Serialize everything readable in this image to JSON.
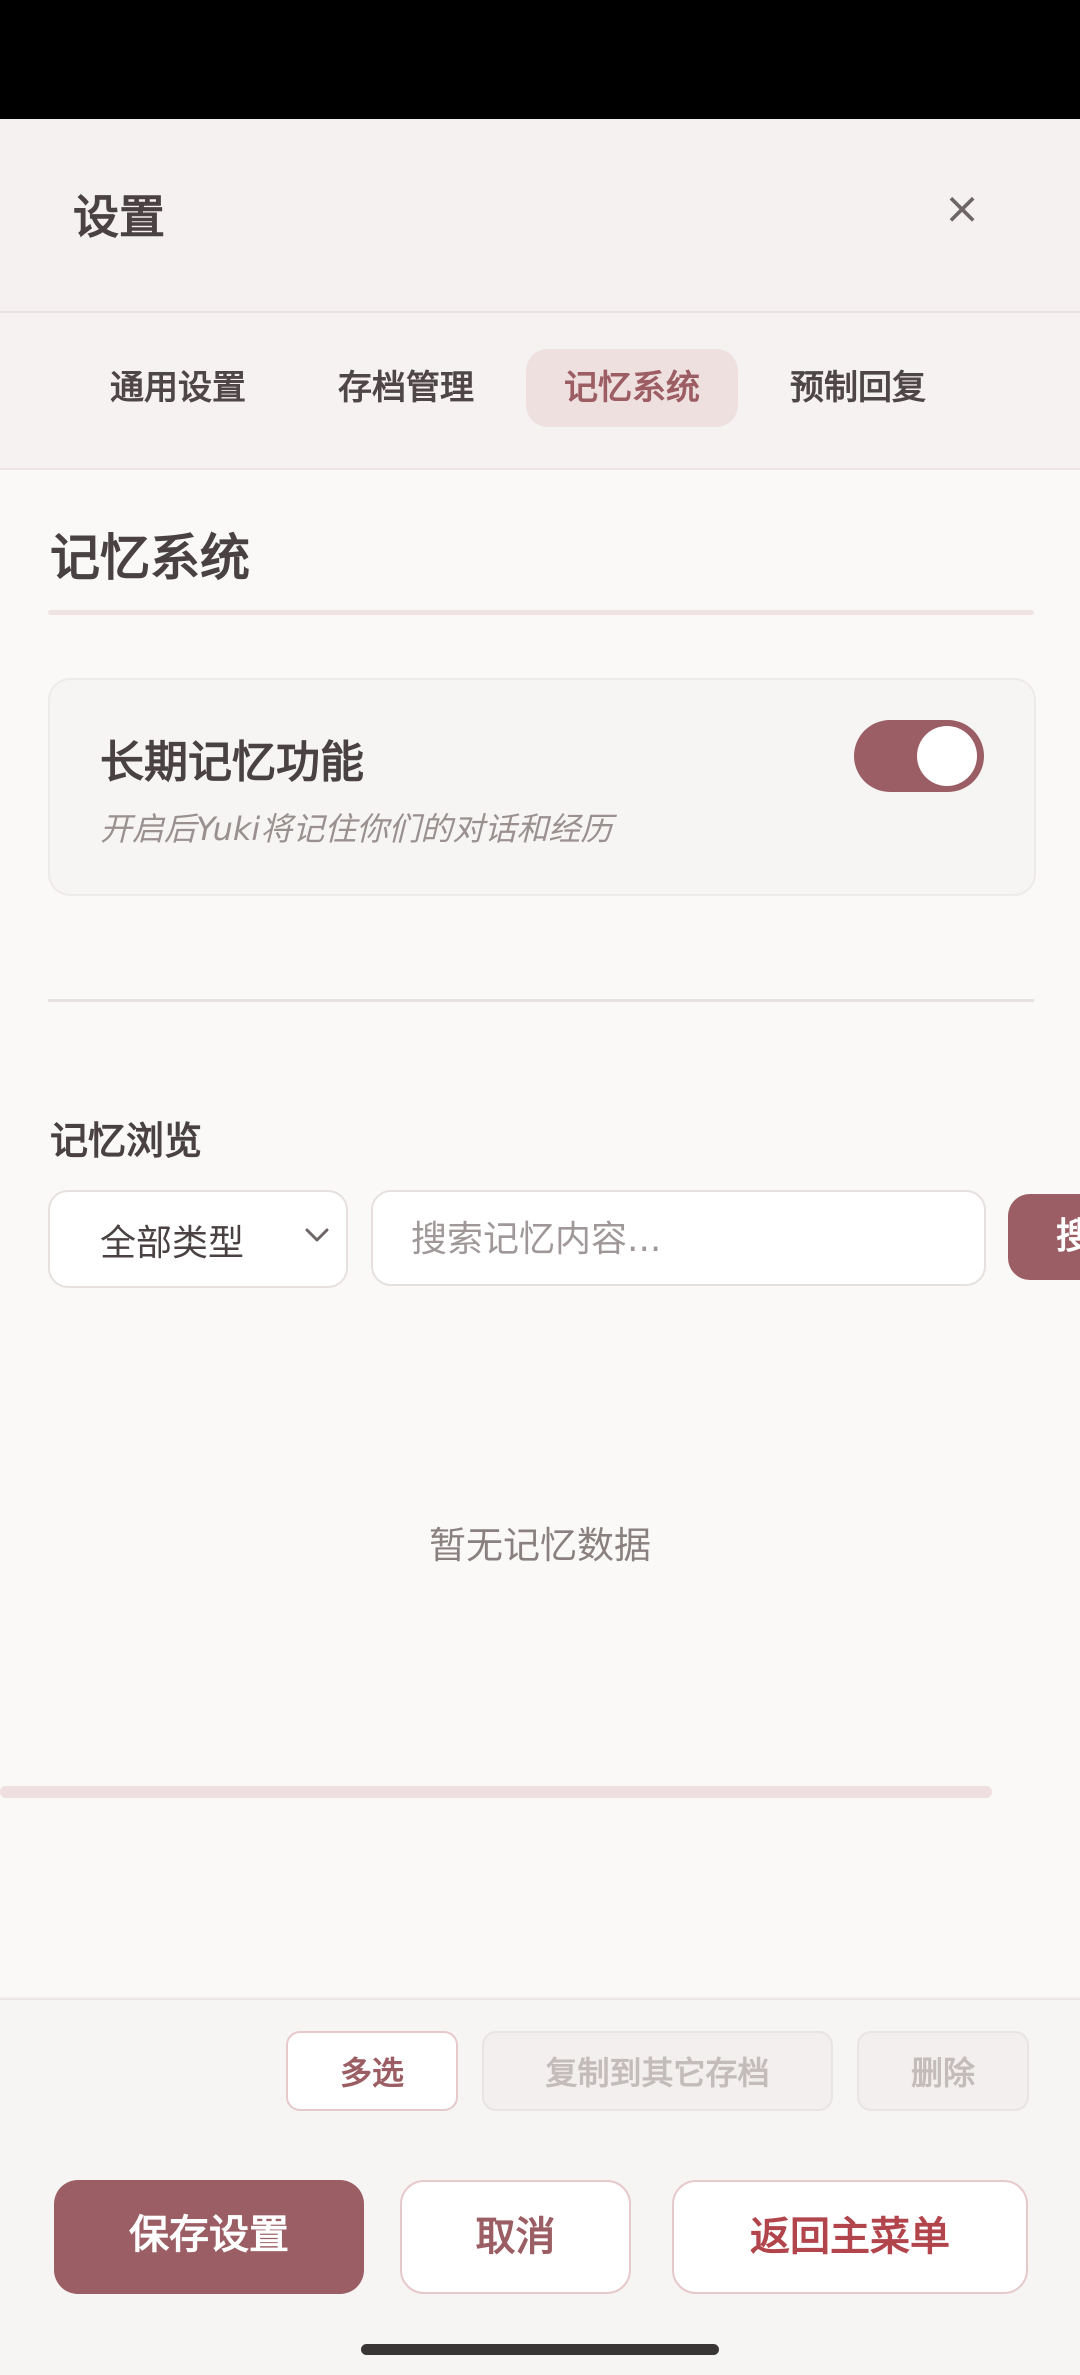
{
  "header": {
    "title": "设置",
    "close_symbol": "×"
  },
  "tabs": [
    {
      "label": "通用设置",
      "active": false
    },
    {
      "label": "存档管理",
      "active": false
    },
    {
      "label": "记忆系统",
      "active": true
    },
    {
      "label": "预制回复",
      "active": false
    }
  ],
  "section": {
    "title": "记忆系统"
  },
  "long_term_memory": {
    "label": "长期记忆功能",
    "description": "开启后Yuki将记住你们的对话和经历",
    "enabled": true
  },
  "browse": {
    "title": "记忆浏览",
    "type_select": "全部类型",
    "search_placeholder": "搜索记忆内容...",
    "search_button": "搜索",
    "empty_text": "暂无记忆数据"
  },
  "actions": {
    "multi_select": "多选",
    "copy_to_other": "复制到其它存档",
    "delete": "删除"
  },
  "footer": {
    "save": "保存设置",
    "cancel": "取消",
    "back_to_menu": "返回主菜单"
  },
  "colors": {
    "accent": "#9a5e64",
    "danger_text": "#b2444c",
    "tab_active_bg": "#efe0e0"
  }
}
